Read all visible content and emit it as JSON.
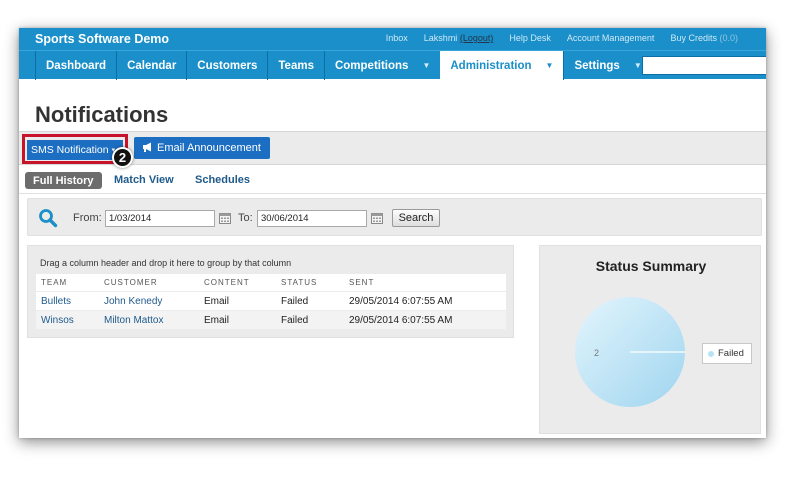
{
  "app": {
    "title": "Sports Software Demo",
    "links": {
      "inbox": "Inbox",
      "user": "Lakshmi",
      "logout": "(Logout)",
      "help_desk": "Help Desk",
      "account_management": "Account Management",
      "buy_credits": "Buy Credits",
      "credits_value": "(0.0)"
    }
  },
  "nav": {
    "items": [
      {
        "label": "Dashboard"
      },
      {
        "label": "Calendar"
      },
      {
        "label": "Customers"
      },
      {
        "label": "Teams"
      },
      {
        "label": "Competitions",
        "caret": "▼"
      },
      {
        "label": "Administration",
        "caret": "▼",
        "active": true
      },
      {
        "label": "Settings",
        "caret": "▼"
      }
    ],
    "search_placeholder": ""
  },
  "page": {
    "title": "Notifications"
  },
  "toolbar": {
    "sms_label": "SMS Notification",
    "sms_caret": "▾",
    "email_label": "Email Announcement",
    "email_icon": "megaphone-icon",
    "step_number": "2"
  },
  "tabs": [
    {
      "label": "Full History",
      "active": true
    },
    {
      "label": "Match View"
    },
    {
      "label": "Schedules"
    }
  ],
  "filter": {
    "from_label": "From:",
    "from_value": "1/03/2014",
    "to_label": "To:",
    "to_value": "30/06/2014",
    "search_label": "Search"
  },
  "grid": {
    "group_hint": "Drag a column header and drop it here to group by that column",
    "columns": [
      "TEAM",
      "CUSTOMER",
      "CONTENT",
      "STATUS",
      "SENT"
    ],
    "rows": [
      [
        "Bullets",
        "John Kenedy",
        "Email",
        "Failed",
        "29/05/2014 6:07:55 AM"
      ],
      [
        "Winsos",
        "Milton Mattox",
        "Email",
        "Failed",
        "29/05/2014 6:07:55 AM"
      ]
    ]
  },
  "status_summary": {
    "title": "Status Summary",
    "chart_data": {
      "type": "pie",
      "categories": [
        "Failed"
      ],
      "values": [
        2
      ],
      "title": "Status Summary",
      "legend": "right"
    },
    "slice_label": "2",
    "legend_label": "Failed"
  },
  "colors": {
    "brand_blue": "#1a8fc9",
    "button_blue": "#1b6ec2",
    "highlight_red": "#c8142a",
    "link_blue": "#1f5a8b",
    "pie_light": "#e3f5fd",
    "pie_dark": "#9fd5ef"
  }
}
